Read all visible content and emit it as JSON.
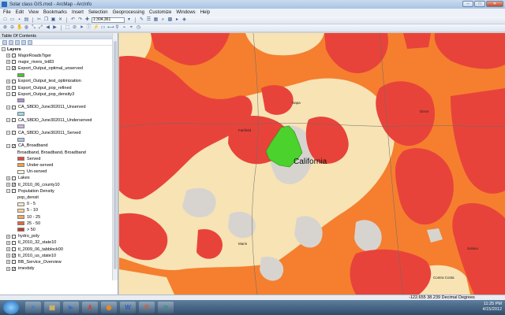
{
  "window": {
    "title": "Solar class GIS.mxd - ArcMap - ArcInfo",
    "buttons": {
      "minimize": "–",
      "maximize": "□",
      "close": "✕"
    }
  },
  "menu": [
    "File",
    "Edit",
    "View",
    "Bookmarks",
    "Insert",
    "Selection",
    "Geoprocessing",
    "Customize",
    "Windows",
    "Help"
  ],
  "toolbar": {
    "scale": "1:304,361"
  },
  "toc": {
    "title": "Table Of Contents",
    "close": "×",
    "root": "Layers",
    "layers": [
      {
        "name": "MajorRoadsTiger",
        "checked": false,
        "expanded": false
      },
      {
        "name": "major_rivers_txt83",
        "checked": false,
        "expanded": false
      },
      {
        "name": "Export_Output_optimal_unserved",
        "checked": true,
        "expanded": true,
        "symbol_color": "#4cc230"
      },
      {
        "name": "Export_Output_test_optimization",
        "checked": false,
        "expanded": false
      },
      {
        "name": "Export_Output_pop_refined",
        "checked": false,
        "expanded": false
      },
      {
        "name": "Export_Output_pop_density3",
        "checked": false,
        "expanded": true,
        "symbol_color": "#b38bd6"
      },
      {
        "name": "CA_SBDD_June302011_Unserved",
        "checked": false,
        "expanded": true,
        "symbol_color": "#9fd9e6"
      },
      {
        "name": "CA_SBDD_June302011_Underserved",
        "checked": false,
        "expanded": true,
        "symbol_color": "#c8b8e0"
      },
      {
        "name": "CA_SBDD_June302011_Served",
        "checked": false,
        "expanded": true,
        "symbol_color": "#a8c8e8"
      },
      {
        "name": "CA_Broadband",
        "checked": true,
        "expanded": true,
        "field": "Broadband, Broadband, Broadband",
        "classes": [
          {
            "label": "Served",
            "color": "#e8433a"
          },
          {
            "label": "Under-served",
            "color": "#f4a23c"
          },
          {
            "label": "Un-served",
            "color": "#f7f2d8"
          }
        ]
      },
      {
        "name": "Lakes",
        "checked": false,
        "expanded": false
      },
      {
        "name": "tl_2010_06_county10",
        "checked": true,
        "expanded": false
      },
      {
        "name": "Population Density",
        "checked": false,
        "expanded": true,
        "field": "pop_densit",
        "classes": [
          {
            "label": "0 - 5",
            "color": "#fbe9c8"
          },
          {
            "label": "5 - 10",
            "color": "#f7d19a"
          },
          {
            "label": "10 - 25",
            "color": "#f3a85e"
          },
          {
            "label": "25 - 50",
            "color": "#e5683a"
          },
          {
            "label": "> 50",
            "color": "#c73a26"
          }
        ]
      },
      {
        "name": "hydro_poly",
        "checked": false,
        "expanded": false
      },
      {
        "name": "tl_2010_32_state10",
        "checked": false,
        "expanded": false
      },
      {
        "name": "tl_2009_06_tabblock00",
        "checked": false,
        "expanded": false
      },
      {
        "name": "tl_2010_us_state10",
        "checked": true,
        "expanded": false
      },
      {
        "name": "BB_Service_Overview",
        "checked": false,
        "expanded": false
      },
      {
        "name": "imexbdy",
        "checked": true,
        "expanded": false
      }
    ]
  },
  "map": {
    "label": "California",
    "places": [
      "Fairfield",
      "Napa",
      "Dixon",
      "Solano",
      "Contra Costa",
      "Marin"
    ],
    "colors": {
      "served": "#e8433a",
      "underserved": "#f57f2f",
      "unserved": "#f8e3b4",
      "water": "#d9d9d9",
      "highlight": "#4bd22d"
    }
  },
  "status": {
    "coords": "-122.655  38.239 Decimal Degrees"
  },
  "taskbar": {
    "apps": [
      "ie-icon",
      "explorer-icon",
      "media-icon",
      "pdf-icon",
      "firefox-icon",
      "word-icon",
      "powerpoint-icon",
      "arcgis-icon"
    ],
    "app_glyphs": [
      "e",
      "▤",
      "▶",
      "A",
      "◉",
      "W",
      "P",
      "◎"
    ],
    "time": "11:25 PM",
    "date": "4/15/2012"
  }
}
